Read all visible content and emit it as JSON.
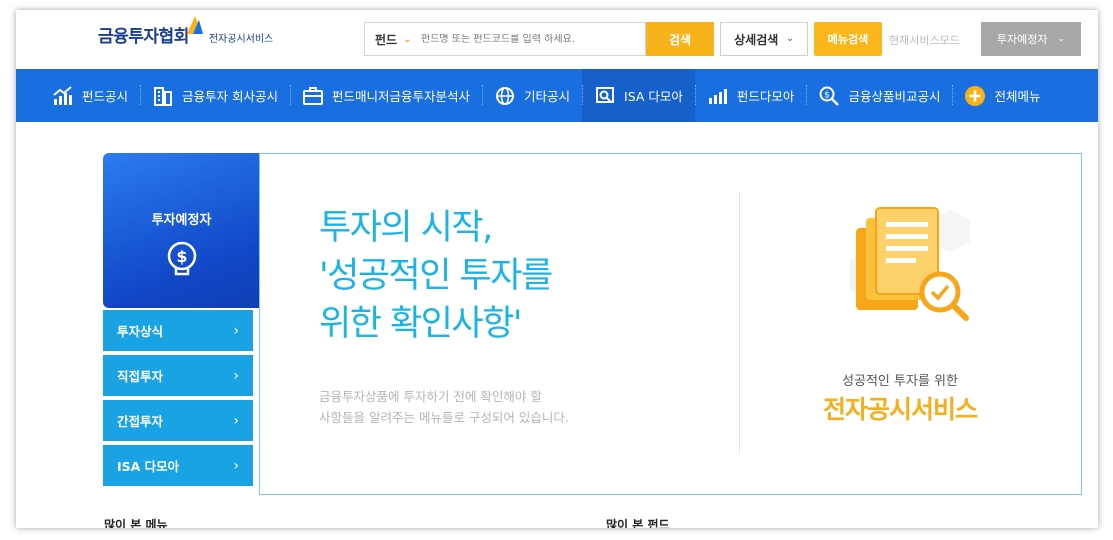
{
  "header": {
    "logo_main": "금융투자협회",
    "logo_sub": "전자공시서비스",
    "search": {
      "category": "펀드",
      "placeholder": "펀드명 또는 펀드코드를 입력 하세요.",
      "button": "검색"
    },
    "advanced_search": "상세검색",
    "menu_search": "메뉴검색",
    "mode_label": "현재서비스모드",
    "mode_value": "투자예정자"
  },
  "nav": {
    "items": [
      {
        "label": "펀드공시",
        "icon": "chart-growth-icon"
      },
      {
        "label": "금융투자 회사공시",
        "icon": "building-icon"
      },
      {
        "label": "펀드매니저금융투자분석사",
        "icon": "briefcase-icon"
      },
      {
        "label": "기타공시",
        "icon": "globe-icon"
      },
      {
        "label": "ISA 다모아",
        "icon": "search-document-icon"
      },
      {
        "label": "펀드다모아",
        "icon": "bar-chart-icon"
      },
      {
        "label": "금융상품비교공시",
        "icon": "magnify-dollar-icon"
      },
      {
        "label": "전체메뉴",
        "icon": "plus-circle-icon"
      }
    ],
    "active_index": 4
  },
  "side": {
    "title": "투자예정자",
    "icon": "lightbulb-dollar-icon",
    "items": [
      "투자상식",
      "직접투자",
      "간접투자",
      "ISA 다모아"
    ]
  },
  "banner": {
    "hero_lines": [
      "투자의 시작,",
      "'성공적인 투자를",
      "위한 확인사항'"
    ],
    "desc_lines": [
      "금융투자상품에 투자하기 전에 확인해야 할",
      "사항들을 알려주는 메뉴들로 구성되어 있습니다."
    ],
    "right_caption": "성공적인 투자를 위한",
    "right_brand": "전자공시서비스"
  },
  "below": {
    "left_title": "많이 본 메뉴",
    "right_title": "많이 본 펀드"
  },
  "colors": {
    "nav_blue": "#1a6fe0",
    "accent_orange": "#f8b31a",
    "side_item": "#1aa3e4",
    "hero_text": "#1ab3e8"
  }
}
